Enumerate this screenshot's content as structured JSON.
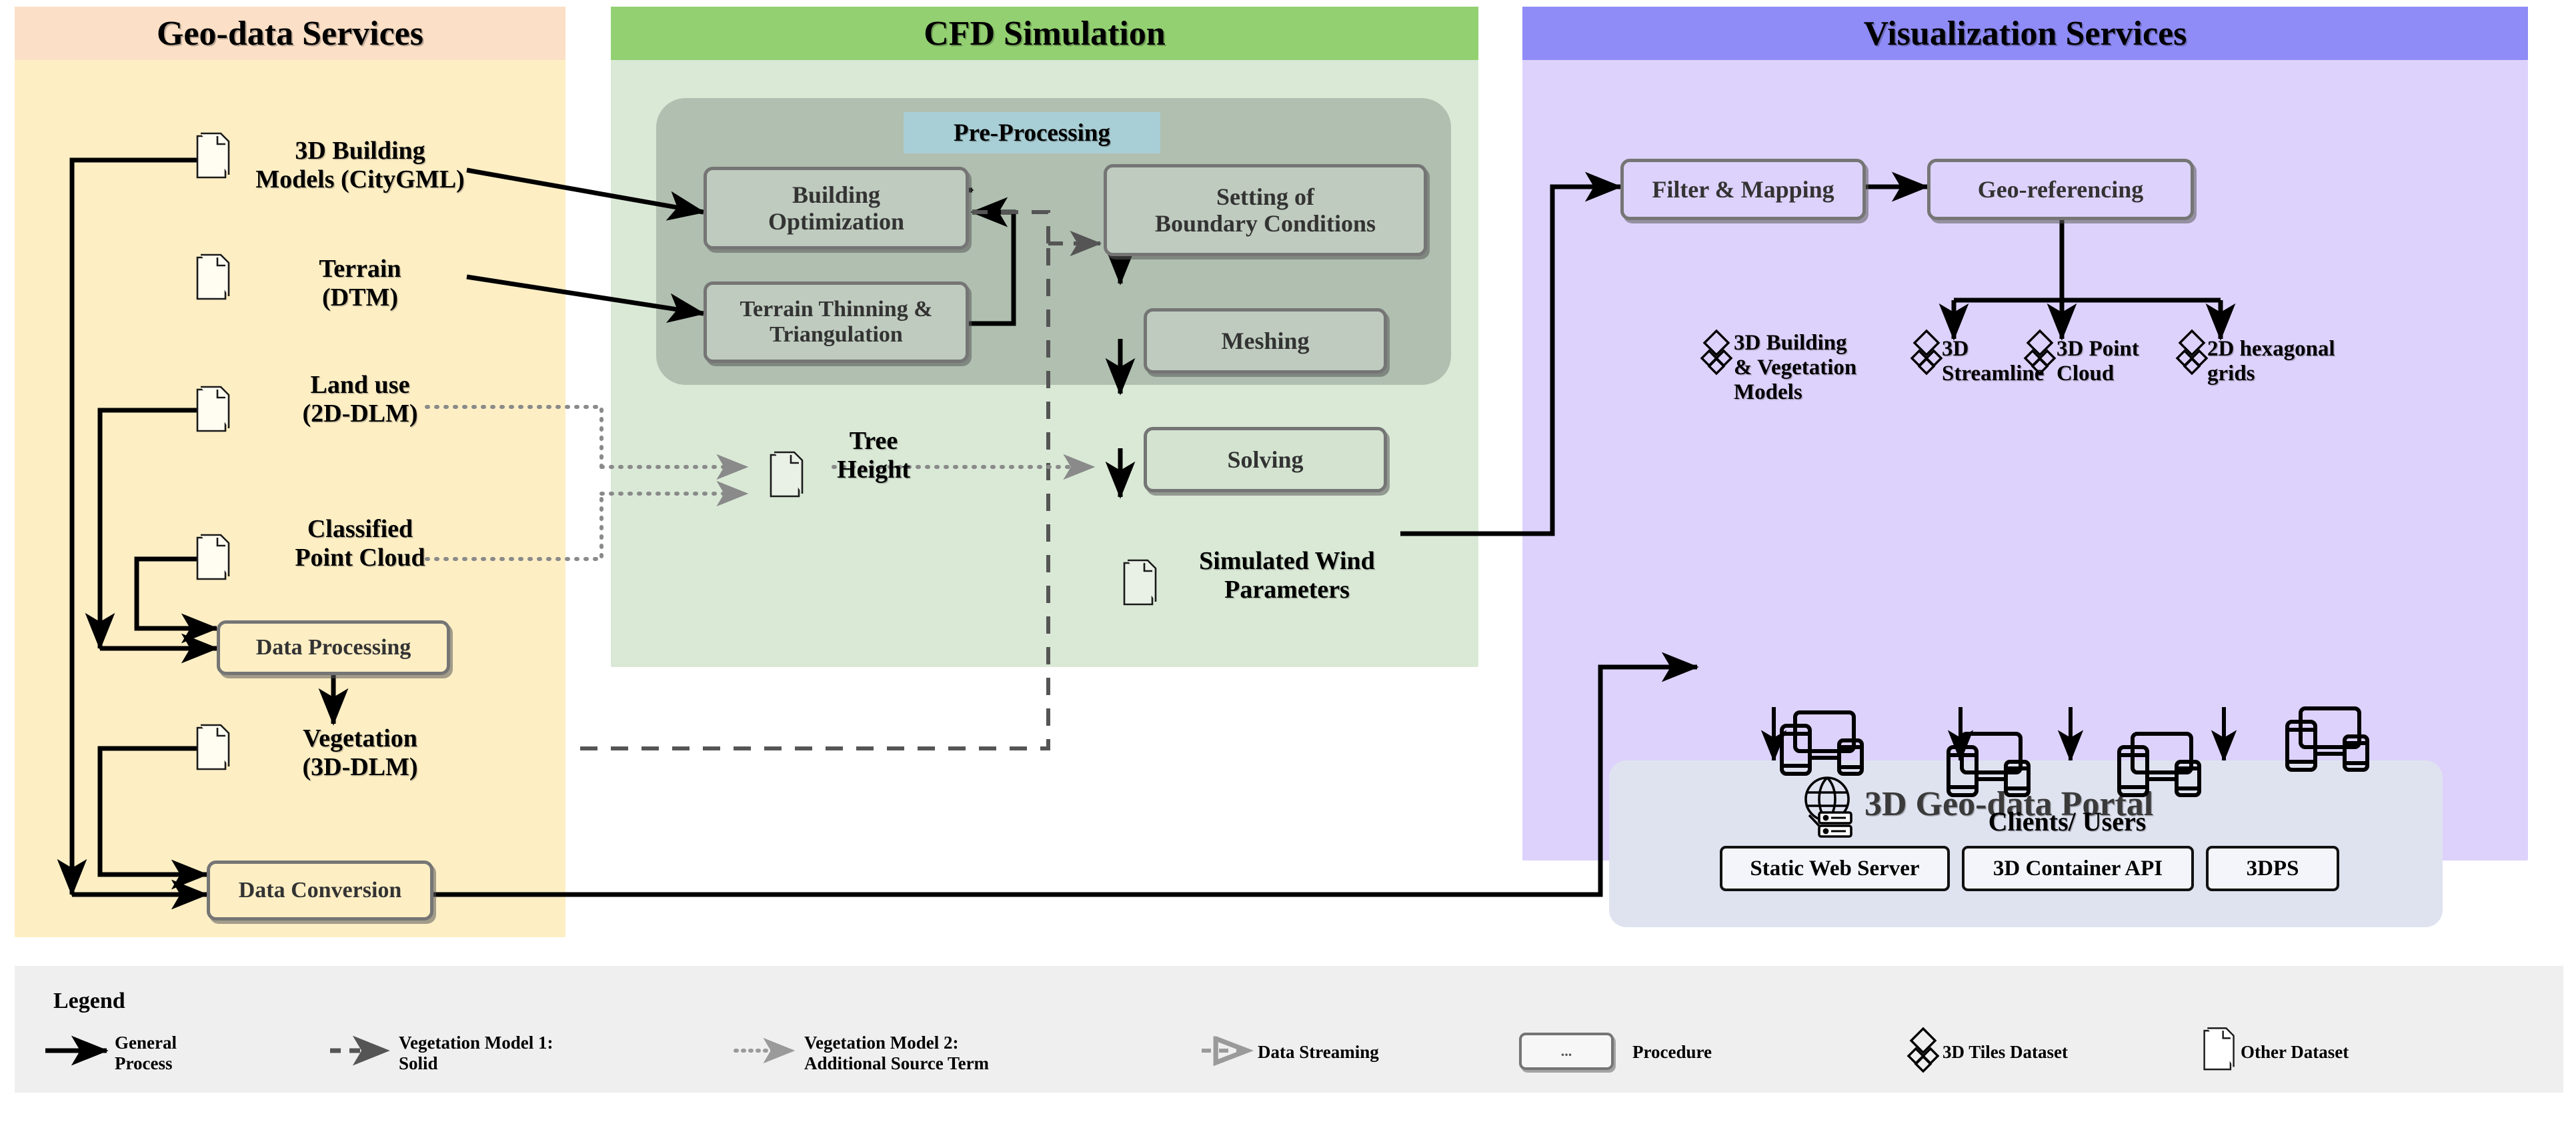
{
  "panels": [
    {
      "id": "geo",
      "title": "Geo-data Services",
      "header_color": "#fbdfc6",
      "body_color": "#fdeec4"
    },
    {
      "id": "cfd",
      "title": "CFD Simulation",
      "header_color": "#93d071",
      "body_color": "#d9e9d6"
    },
    {
      "id": "viz",
      "title": "Visualization Services",
      "header_color": "#8f8cf7",
      "body_color": "#ddd2fb"
    }
  ],
  "geo": {
    "datasets": [
      {
        "id": "building",
        "label": "3D Building\nModels (CityGML)"
      },
      {
        "id": "terrain",
        "label": "Terrain\n(DTM)"
      },
      {
        "id": "landuse",
        "label": "Land use\n(2D-DLM)"
      },
      {
        "id": "pointcloud",
        "label": "Classified\nPoint Cloud"
      },
      {
        "id": "vegetation",
        "label": "Vegetation\n(3D-DLM)"
      }
    ],
    "procedures": [
      {
        "id": "data-processing",
        "label": "Data Processing"
      },
      {
        "id": "data-conversion",
        "label": "Data Conversion"
      }
    ]
  },
  "cfd": {
    "preprocessing_label": "Pre-Processing",
    "preprocessing_color": "#a9cfd6",
    "procedures": [
      {
        "id": "building-optimization",
        "label": "Building\nOptimization"
      },
      {
        "id": "terrain-thinning",
        "label": "Terrain Thinning &\nTriangulation"
      },
      {
        "id": "boundary-conditions",
        "label": "Setting of\nBoundary Conditions"
      },
      {
        "id": "meshing",
        "label": "Meshing"
      },
      {
        "id": "solving",
        "label": "Solving"
      }
    ],
    "datasets": [
      {
        "id": "tree-height",
        "label": "Tree\nHeight"
      },
      {
        "id": "simulated-wind",
        "label": "Simulated Wind\nParameters"
      }
    ]
  },
  "viz": {
    "procedures": [
      {
        "id": "filter-mapping",
        "label": "Filter & Mapping"
      },
      {
        "id": "geo-referencing",
        "label": "Geo-referencing"
      }
    ],
    "tiles": [
      {
        "id": "building-vegetation-models",
        "label": "3D Building\n& Vegetation\nModels"
      },
      {
        "id": "streamline",
        "label": "3D\nStreamline"
      },
      {
        "id": "point-cloud",
        "label": "3D Point\nCloud"
      },
      {
        "id": "hex-grids",
        "label": "2D hexagonal\ngrids"
      }
    ],
    "portal": {
      "title": "3D Geo-data Portal",
      "background": "#dfe3f0",
      "services": [
        {
          "id": "static-web-server",
          "label": "Static Web Server"
        },
        {
          "id": "container-api",
          "label": "3D Container API"
        },
        {
          "id": "3dps",
          "label": "3DPS"
        }
      ]
    },
    "clients_label": "Clients/ Users"
  },
  "legend": {
    "title": "Legend",
    "background": "#efefef",
    "items": [
      {
        "id": "general-process",
        "label": "General\nProcess",
        "style": "solid",
        "color": "#000000"
      },
      {
        "id": "vegetation-model-1",
        "label": "Vegetation Model 1:\nSolid",
        "style": "dashed",
        "color": "#555555"
      },
      {
        "id": "vegetation-model-2",
        "label": "Vegetation Model 2:\nAdditional Source Term",
        "style": "dotted",
        "color": "#888888"
      },
      {
        "id": "data-streaming",
        "label": "Data Streaming",
        "style": "dashed-open",
        "color": "#999999"
      },
      {
        "id": "procedure",
        "label": "Procedure",
        "style": "box",
        "box_text": "..."
      },
      {
        "id": "3d-tiles-dataset",
        "label": "3D Tiles Dataset",
        "style": "tiles-icon"
      },
      {
        "id": "other-dataset",
        "label": "Other Dataset",
        "style": "doc-icon"
      }
    ]
  }
}
